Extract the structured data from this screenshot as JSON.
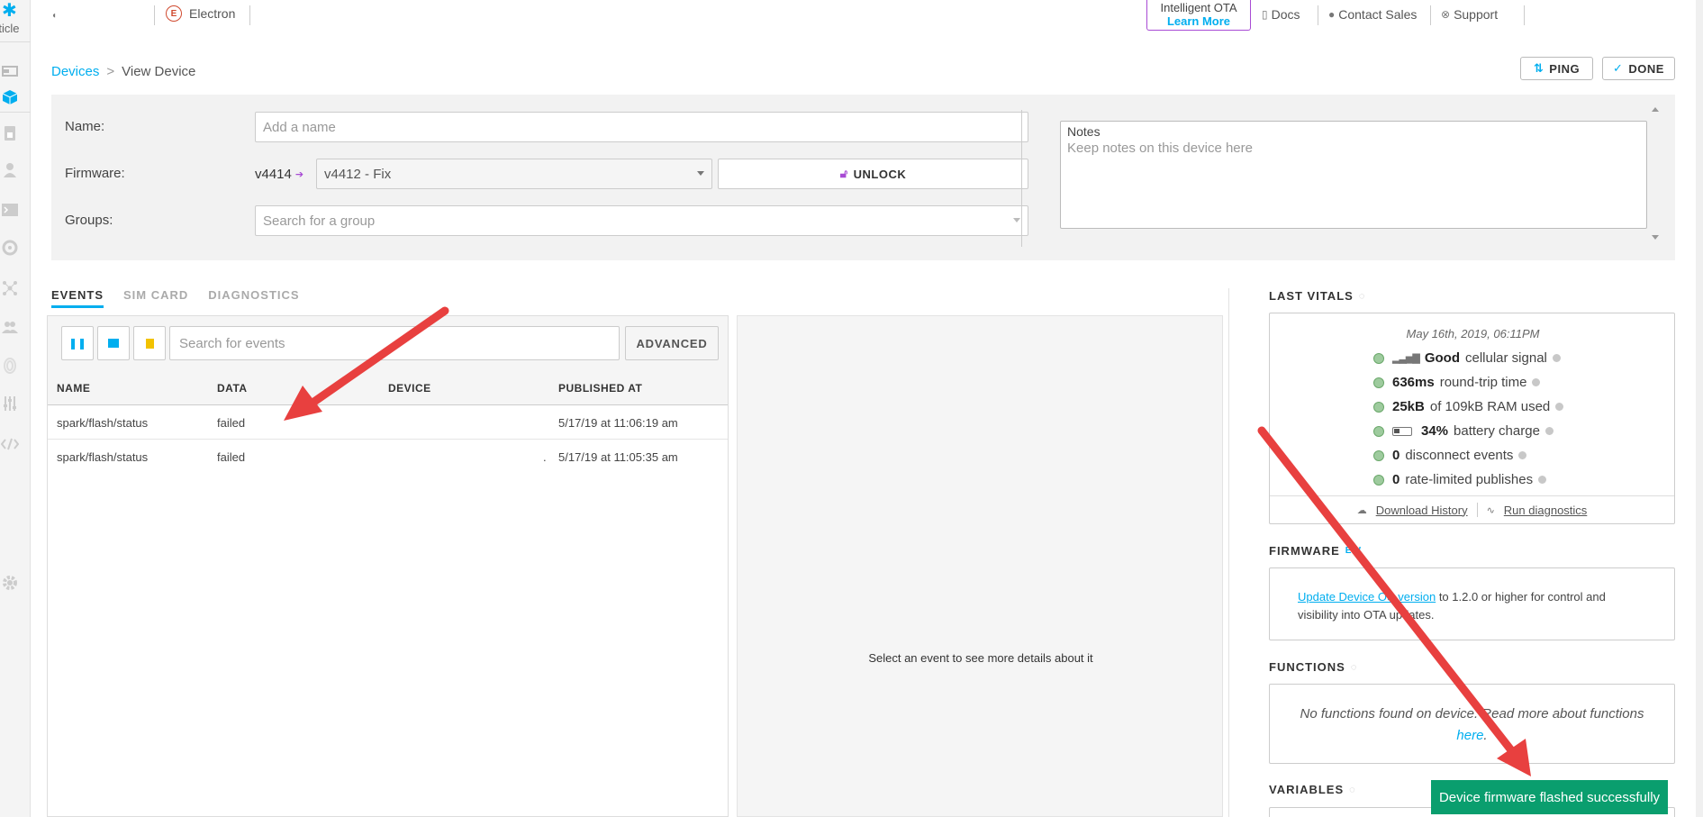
{
  "brand": {
    "logo_text": "rticle"
  },
  "topnav": {
    "device_type": "Electron",
    "device_type_badge": "E",
    "ota_title": "Intelligent OTA",
    "ota_link": "Learn More",
    "docs": "Docs",
    "contact_sales": "Contact Sales",
    "support": "Support"
  },
  "breadcrumb": {
    "parent": "Devices",
    "separator": ">",
    "current": "View Device"
  },
  "actions": {
    "ping": "PING",
    "done": "DONE"
  },
  "device": {
    "name_label": "Name:",
    "name_placeholder": "Add a name",
    "firmware_label": "Firmware:",
    "firmware_current": "v4414",
    "firmware_selected": "v4412 - Fix",
    "unlock": "UNLOCK",
    "groups_label": "Groups:",
    "groups_placeholder": "Search for a group",
    "notes_label": "Notes",
    "notes_placeholder": "Keep notes on this device here"
  },
  "tabs": [
    {
      "label": "EVENTS",
      "active": true
    },
    {
      "label": "SIM CARD",
      "active": false
    },
    {
      "label": "DIAGNOSTICS",
      "active": false
    }
  ],
  "events": {
    "search_placeholder": "Search for events",
    "advanced": "ADVANCED",
    "columns": [
      "NAME",
      "DATA",
      "DEVICE",
      "PUBLISHED AT"
    ],
    "rows": [
      {
        "name": "spark/flash/status",
        "data": "failed",
        "device": "",
        "published_at": "5/17/19 at 11:06:19 am"
      },
      {
        "name": "spark/flash/status",
        "data": "failed",
        "device": ".",
        "published_at": "5/17/19 at 11:05:35 am"
      }
    ],
    "detail_empty": "Select an event to see more details about it"
  },
  "vitals": {
    "title": "LAST VITALS",
    "date": "May 16th, 2019, 06:11PM",
    "items": [
      {
        "value": "Good",
        "text": "cellular signal"
      },
      {
        "value": "636ms",
        "text": "round-trip time"
      },
      {
        "value": "25kB",
        "text": "of 109kB RAM used"
      },
      {
        "value": "34%",
        "text": "battery charge"
      },
      {
        "value": "0",
        "text": "disconnect events"
      },
      {
        "value": "0",
        "text": "rate-limited publishes"
      }
    ],
    "download_history": "Download History",
    "run_diagnostics": "Run diagnostics"
  },
  "firmware_section": {
    "title": "FIRMWARE",
    "badge": "EW",
    "link": "Update Device OS version",
    "text": "to 1.2.0 or higher for control and visibility into OTA updates."
  },
  "functions": {
    "title": "FUNCTIONS",
    "empty_text": "No functions found on device. Read more about functions",
    "link": "here"
  },
  "variables": {
    "title": "VARIABLES"
  },
  "toast": "Device firmware flashed successfully",
  "colors": {
    "accent": "#00aeef",
    "success": "#0a9e6e",
    "ota": "#a84bd4",
    "arrow": "#e8403f"
  }
}
